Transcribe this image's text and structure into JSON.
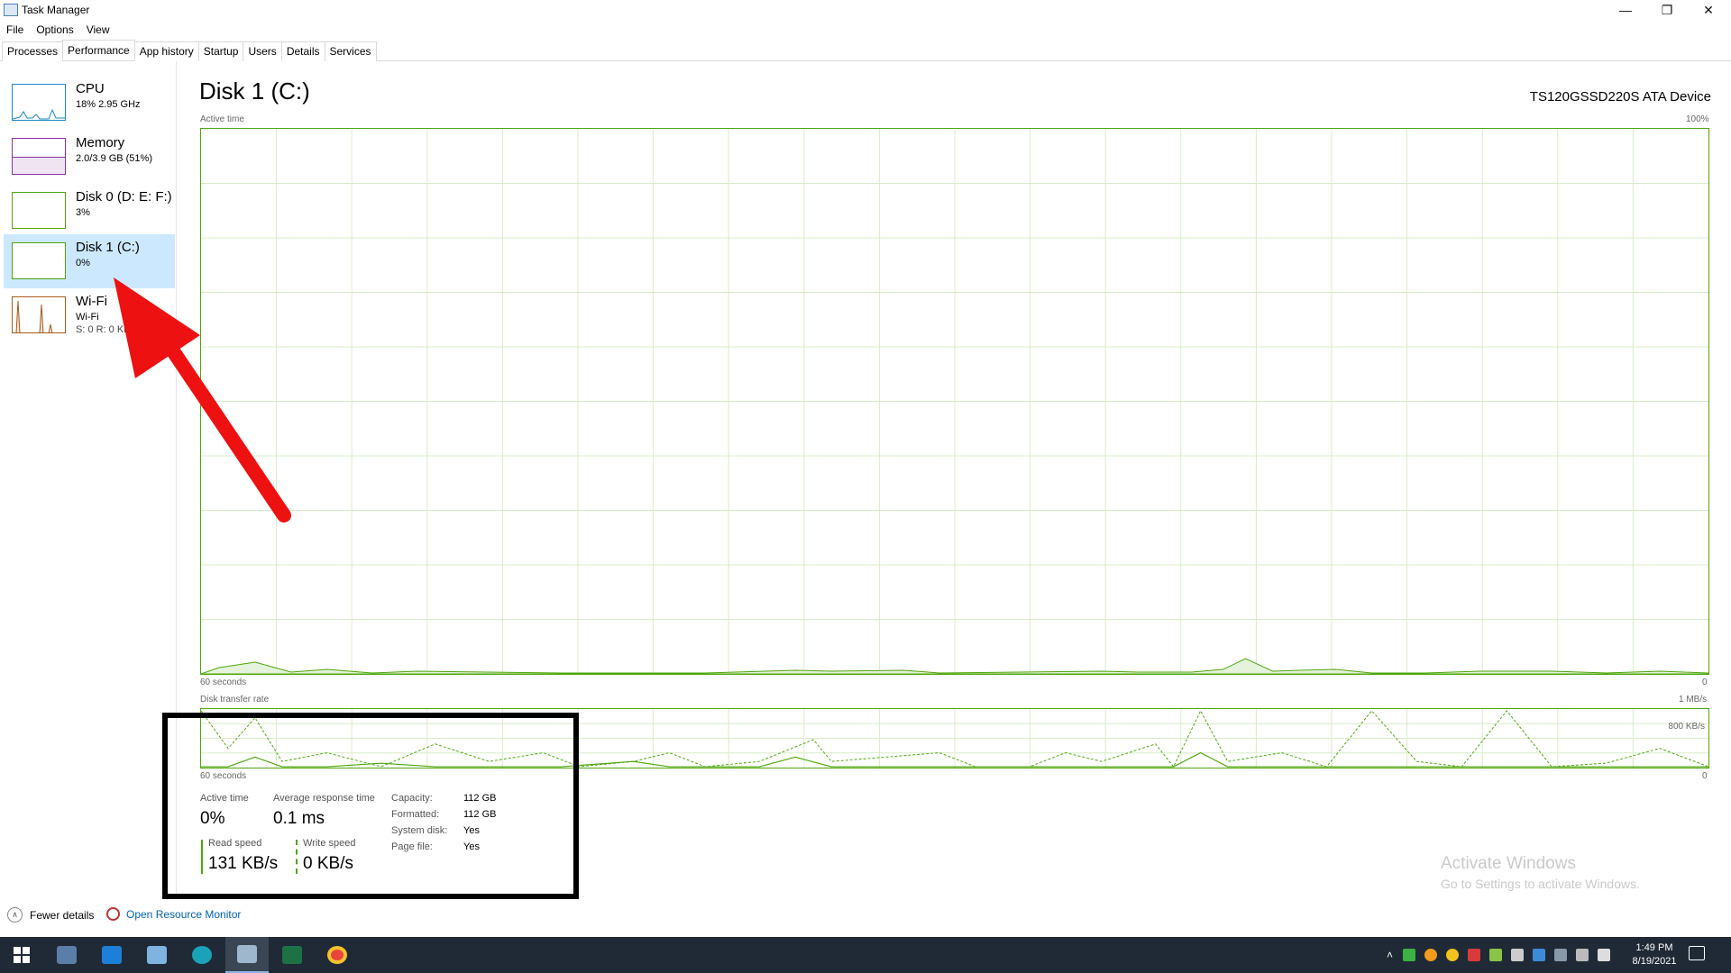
{
  "window": {
    "title": "Task Manager",
    "minimize_glyph": "—",
    "maximize_glyph": "❐",
    "close_glyph": "✕"
  },
  "menu": [
    "File",
    "Options",
    "View"
  ],
  "tabs": [
    "Processes",
    "Performance",
    "App history",
    "Startup",
    "Users",
    "Details",
    "Services"
  ],
  "active_tab": "Performance",
  "sidebar": {
    "items": [
      {
        "name": "CPU",
        "sub": "18% 2.95 GHz",
        "color": "#1e88c8"
      },
      {
        "name": "Memory",
        "sub": "2.0/3.9 GB (51%)",
        "color": "#8b2fa6"
      },
      {
        "name": "Disk 0 (D: E: F:)",
        "sub": "3%",
        "color": "#4da60c"
      },
      {
        "name": "Disk 1 (C:)",
        "sub": "0%",
        "color": "#4da60c"
      },
      {
        "name": "Wi-Fi",
        "sub": "Wi-Fi",
        "sub2": "S: 0 R: 0 Kb",
        "color": "#a75a1a"
      }
    ],
    "selected": "Disk 1 (C:)"
  },
  "main": {
    "title": "Disk 1 (C:)",
    "device": "TS120GSSD220S ATA Device",
    "active_time_label": "Active time",
    "active_time_max": "100%",
    "active_time_xlabel": "60 seconds",
    "active_time_min": "0",
    "transfer_label": "Disk transfer rate",
    "transfer_max": "1 MB/s",
    "transfer_mid": "800 KB/s",
    "transfer_xlabel": "60 seconds",
    "transfer_min": "0"
  },
  "stats": {
    "active_time_label": "Active time",
    "active_time_value": "0%",
    "avg_response_label": "Average response time",
    "avg_response_value": "0.1 ms",
    "read_label": "Read speed",
    "read_value": "131 KB/s",
    "write_label": "Write speed",
    "write_value": "0 KB/s"
  },
  "properties": [
    {
      "label": "Capacity:",
      "value": "112 GB"
    },
    {
      "label": "Formatted:",
      "value": "112 GB"
    },
    {
      "label": "System disk:",
      "value": "Yes"
    },
    {
      "label": "Page file:",
      "value": "Yes"
    }
  ],
  "footer": {
    "fewer_details": "Fewer details",
    "open_resource_monitor": "Open Resource Monitor"
  },
  "watermark": {
    "line1": "Activate Windows",
    "line2": "Go to Settings to activate Windows."
  },
  "taskbar": {
    "time": "1:49 PM",
    "date": "8/19/2021",
    "apps": [
      "start-icon",
      "calculator-icon",
      "mail-icon",
      "notepad-icon",
      "edge-icon",
      "task-manager-icon",
      "excel-icon",
      "chrome-icon"
    ]
  },
  "colors": {
    "disk_green": "#4da60c",
    "selection": "#cce8ff",
    "link": "#0063b1",
    "annotation_arrow": "#ee1111",
    "taskbar": "#1f2a36"
  }
}
